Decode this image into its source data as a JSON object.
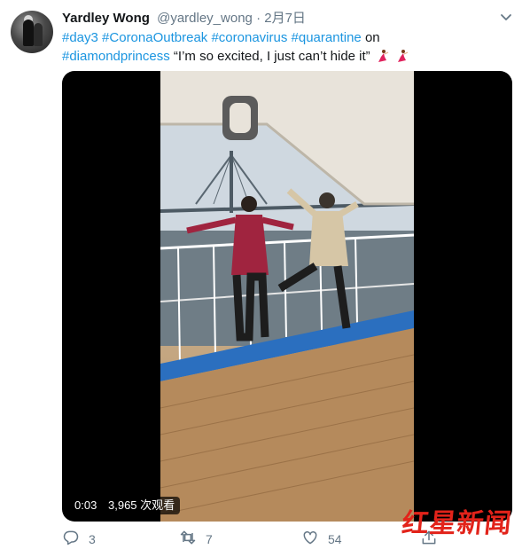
{
  "tweet": {
    "display_name": "Yardley Wong",
    "handle": "@yardley_wong",
    "separator": "·",
    "date": "2月7日",
    "text": {
      "tags_line1": [
        "#day3",
        "#CoronaOutbreak",
        "#coronavirus",
        "#quarantine"
      ],
      "connector": "on",
      "tag_line2": "#diamondprincess",
      "quote": "“I’m so excited, I just can’t hide it”",
      "emoji": "dancer-emoji"
    }
  },
  "video": {
    "elapsed": "0:03",
    "views": "3,965 次观看"
  },
  "actions": {
    "reply_count": "3",
    "retweet_count": "7",
    "like_count": "54"
  },
  "watermark": {
    "logo_text": "红星新闻"
  },
  "colors": {
    "link": "#1b95e0",
    "muted": "#657786",
    "text": "#14171a",
    "watermark": "#e2231a"
  },
  "icons": [
    "chevron-down-icon",
    "reply-icon",
    "retweet-icon",
    "heart-icon",
    "share-icon"
  ]
}
